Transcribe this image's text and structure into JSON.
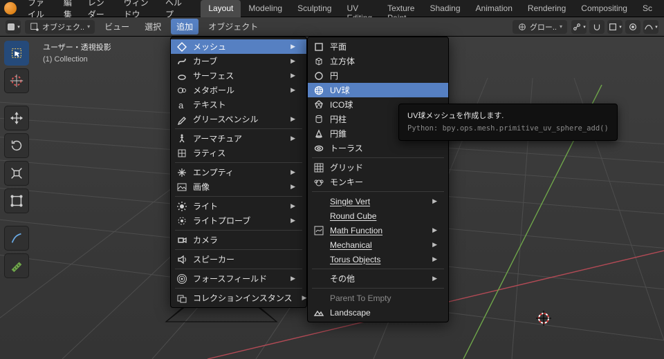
{
  "top": {
    "menus": [
      "ファイル",
      "編集",
      "レンダー",
      "ウィンドウ",
      "ヘルプ"
    ],
    "tabs": [
      "Layout",
      "Modeling",
      "Sculpting",
      "UV Editing",
      "Texture Paint",
      "Shading",
      "Animation",
      "Rendering",
      "Compositing",
      "Sc"
    ],
    "active_tab": 0
  },
  "header": {
    "mode": "オブジェク..",
    "items_left": [
      "ビュー",
      "選択",
      "追加",
      "オブジェクト"
    ],
    "active_item": 2,
    "pivot": "グロー.."
  },
  "overlay": {
    "line1": "ユーザー・透視投影",
    "line2": "(1) Collection"
  },
  "add_menu": {
    "items": [
      {
        "label": "メッシュ",
        "icon": "mesh",
        "sub": true,
        "hi": true
      },
      {
        "label": "カーブ",
        "icon": "curve",
        "sub": true
      },
      {
        "label": "サーフェス",
        "icon": "surface",
        "sub": true
      },
      {
        "label": "メタボール",
        "icon": "meta",
        "sub": true
      },
      {
        "label": "テキスト",
        "icon": "text"
      },
      {
        "label": "グリースペンシル",
        "icon": "gpencil",
        "sub": true
      },
      {
        "sep": true
      },
      {
        "label": "アーマチュア",
        "icon": "armature",
        "sub": true
      },
      {
        "label": "ラティス",
        "icon": "lattice"
      },
      {
        "sep": true
      },
      {
        "label": "エンプティ",
        "icon": "empty",
        "sub": true
      },
      {
        "label": "画像",
        "icon": "image",
        "sub": true
      },
      {
        "sep": true
      },
      {
        "label": "ライト",
        "icon": "light",
        "sub": true
      },
      {
        "label": "ライトプローブ",
        "icon": "probe",
        "sub": true
      },
      {
        "sep": true
      },
      {
        "label": "カメラ",
        "icon": "camera"
      },
      {
        "sep": true
      },
      {
        "label": "スピーカー",
        "icon": "speaker"
      },
      {
        "sep": true
      },
      {
        "label": "フォースフィールド",
        "icon": "force",
        "sub": true
      },
      {
        "sep": true
      },
      {
        "label": "コレクションインスタンス",
        "icon": "collection",
        "sub": true
      }
    ]
  },
  "mesh_menu": {
    "items": [
      {
        "label": "平面",
        "icon": "plane"
      },
      {
        "label": "立方体",
        "icon": "cube"
      },
      {
        "label": "円",
        "icon": "circle"
      },
      {
        "label": "UV球",
        "icon": "uvsphere",
        "hi": true
      },
      {
        "label": "ICO球",
        "icon": "ico"
      },
      {
        "label": "円柱",
        "icon": "cyl"
      },
      {
        "label": "円錐",
        "icon": "cone"
      },
      {
        "label": "トーラス",
        "icon": "torus"
      },
      {
        "sep": true
      },
      {
        "label": "グリッド",
        "icon": "grid"
      },
      {
        "label": "モンキー",
        "icon": "monkey"
      },
      {
        "sep": true
      },
      {
        "label": "Single Vert",
        "sub": true,
        "ul": true
      },
      {
        "label": "Round Cube",
        "ul": true
      },
      {
        "label": "Math Function",
        "icon": "fn",
        "sub": true,
        "ul": true
      },
      {
        "label": "Mechanical",
        "sub": true,
        "ul": true
      },
      {
        "label": "Torus Objects",
        "sub": true,
        "ul": true
      },
      {
        "sep": true
      },
      {
        "label": "その他",
        "sub": true
      },
      {
        "sep": true
      },
      {
        "label": "Parent To Empty",
        "dim": true
      },
      {
        "label": "Landscape",
        "icon": "landscape"
      }
    ]
  },
  "tooltip": {
    "line1": "UV球メッシュを作成します.",
    "line2": "Python: bpy.ops.mesh.primitive_uv_sphere_add()"
  }
}
